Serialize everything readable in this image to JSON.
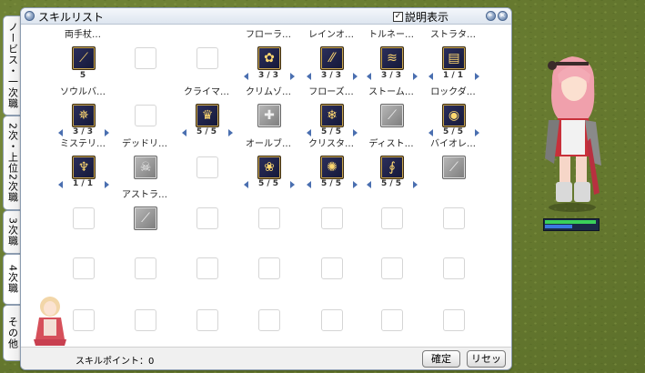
{
  "window": {
    "title": "スキルリスト",
    "description_toggle": {
      "label": "説明表示",
      "checked": true
    },
    "controls": [
      "minimize",
      "close"
    ]
  },
  "tabs": [
    {
      "label": "ノービス・一次職",
      "active": false
    },
    {
      "label": "2次・上位2次職",
      "active": false
    },
    {
      "label": "3次職",
      "active": false
    },
    {
      "label": "4次職",
      "active": true
    },
    {
      "label": "その他",
      "active": false
    }
  ],
  "skills": [
    {
      "name": "両手杖…",
      "level": "5",
      "icon": "staff-icon",
      "learned": true,
      "arrows": false
    },
    {
      "name": "フローラ…",
      "level": "3 / 3",
      "icon": "flower-icon",
      "learned": true,
      "arrows": true
    },
    {
      "name": "レインオ…",
      "level": "3 / 3",
      "icon": "rain-icon",
      "learned": true,
      "arrows": true
    },
    {
      "name": "トルネー…",
      "level": "3 / 3",
      "icon": "tornado-icon",
      "learned": true,
      "arrows": true
    },
    {
      "name": "ストラタ…",
      "level": "1 / 1",
      "icon": "strata-icon",
      "learned": true,
      "arrows": true
    },
    {
      "name": "ソウルバ…",
      "level": "3 / 3",
      "icon": "soul-icon",
      "learned": true,
      "arrows": true
    },
    {
      "name": "クライマ…",
      "level": "5 / 5",
      "icon": "climax-icon",
      "learned": true,
      "arrows": true
    },
    {
      "name": "クリムゾ…",
      "level": "",
      "icon": "crimson-icon",
      "learned": false,
      "arrows": false
    },
    {
      "name": "フローズ…",
      "level": "5 / 5",
      "icon": "frozen-icon",
      "learned": true,
      "arrows": true
    },
    {
      "name": "ストーム…",
      "level": "",
      "icon": "storm-icon",
      "learned": false,
      "arrows": false
    },
    {
      "name": "ロックダ…",
      "level": "5 / 5",
      "icon": "rock-icon",
      "learned": true,
      "arrows": true
    },
    {
      "name": "ミステリ…",
      "level": "1 / 1",
      "icon": "mystery-icon",
      "learned": true,
      "arrows": true
    },
    {
      "name": "デッドリ…",
      "level": "",
      "icon": "deadly-icon",
      "learned": false,
      "arrows": false
    },
    {
      "name": "オールブ…",
      "level": "5 / 5",
      "icon": "allbloom-icon",
      "learned": true,
      "arrows": true
    },
    {
      "name": "クリスタ…",
      "level": "5 / 5",
      "icon": "crystal-icon",
      "learned": true,
      "arrows": true
    },
    {
      "name": "ディスト…",
      "level": "5 / 5",
      "icon": "distort-icon",
      "learned": true,
      "arrows": true
    },
    {
      "name": "バイオレ…",
      "level": "",
      "icon": "violent-icon",
      "learned": false,
      "arrows": false
    },
    {
      "name": "アストラ…",
      "level": "",
      "icon": "astral-icon",
      "learned": false,
      "arrows": false
    }
  ],
  "footer": {
    "skill_points": "スキルポイント：0",
    "confirm_label": "確定",
    "reset_label": "リセット"
  },
  "colors": {
    "accent": "#4a6fb0",
    "window_border": "#8c9cb0"
  }
}
